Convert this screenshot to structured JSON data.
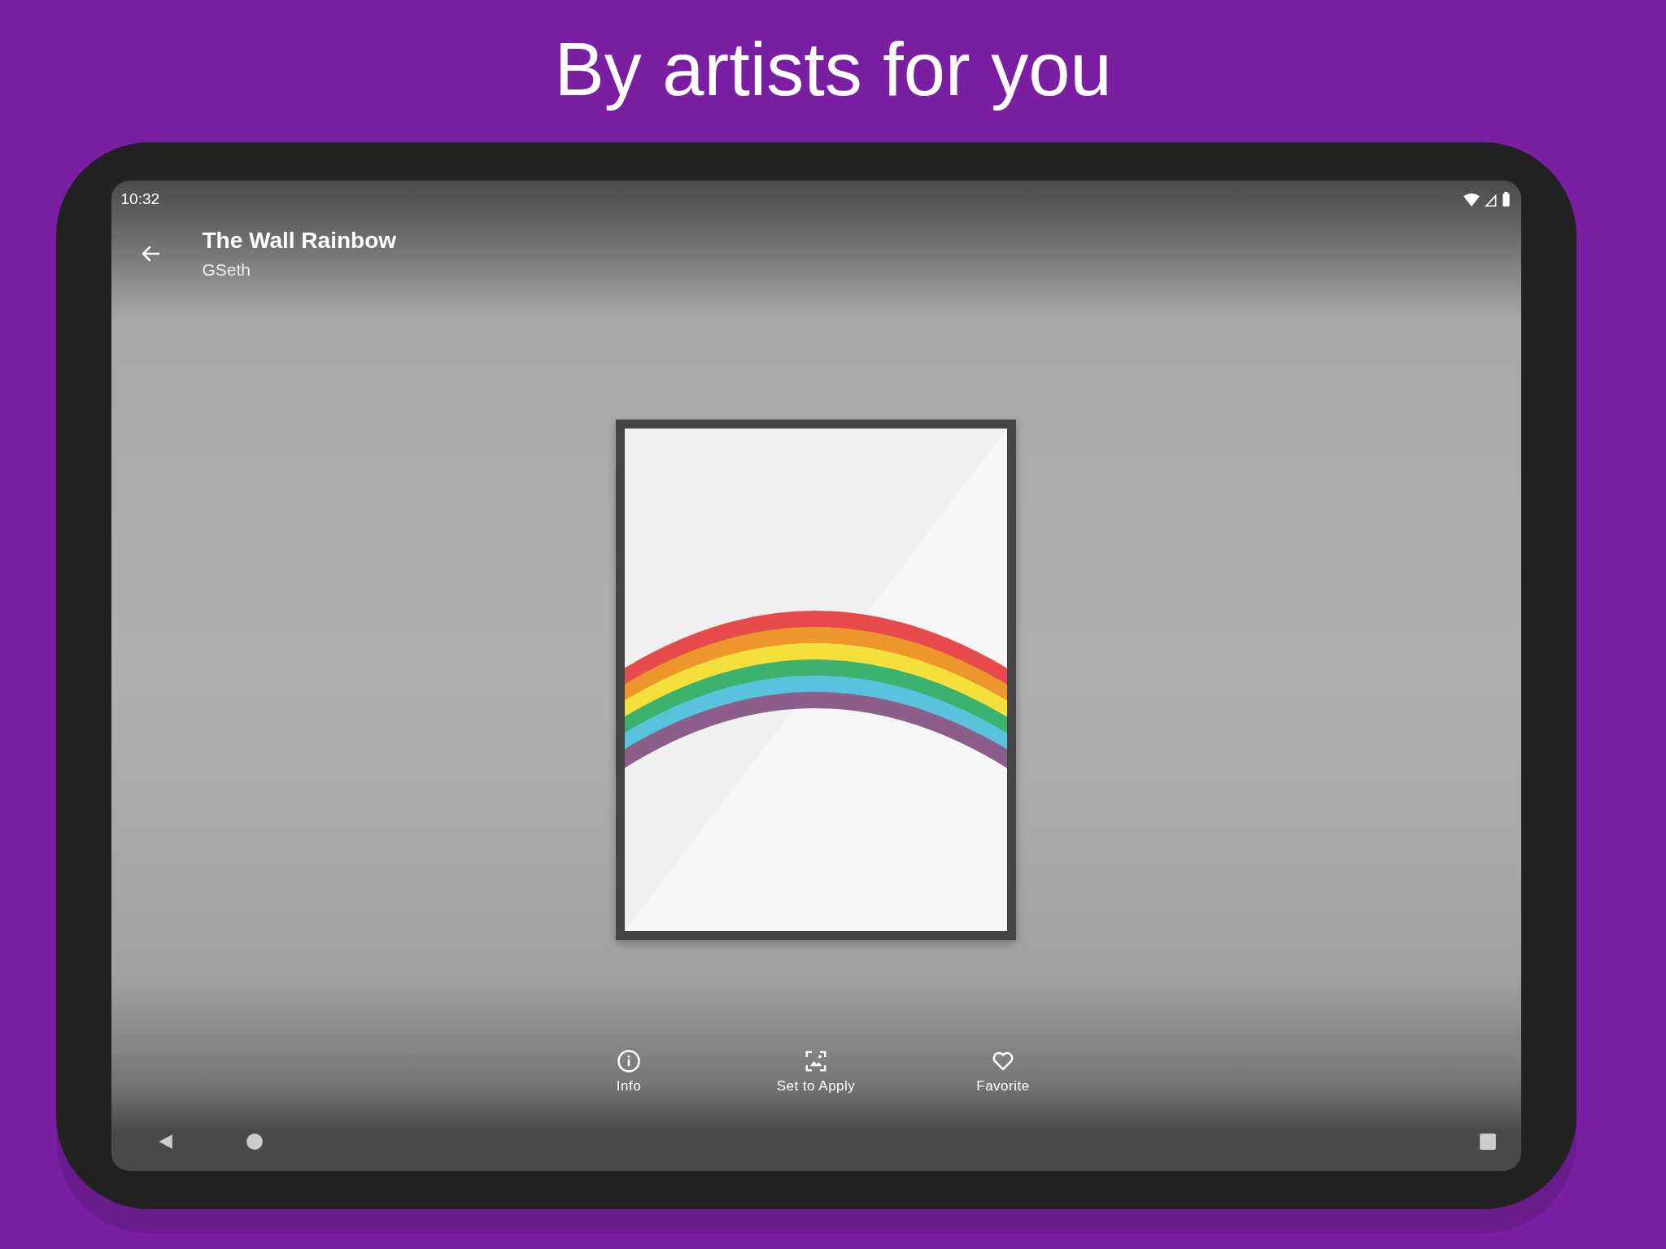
{
  "headline": "By artists for you",
  "status_bar": {
    "time": "10:32"
  },
  "app_bar": {
    "title": "The Wall Rainbow",
    "subtitle": "GSeth"
  },
  "actions": [
    {
      "kind": "info",
      "label": "Info"
    },
    {
      "kind": "apply",
      "label": "Set to Apply"
    },
    {
      "kind": "favorite",
      "label": "Favorite"
    }
  ]
}
